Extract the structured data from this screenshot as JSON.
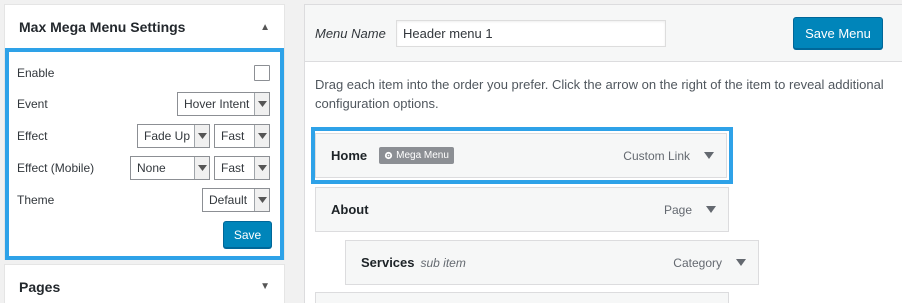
{
  "settings": {
    "title": "Max Mega Menu Settings",
    "enable_label": "Enable",
    "event_label": "Event",
    "event_value": "Hover Intent",
    "effect_label": "Effect",
    "effect_value": "Fade Up",
    "effect_speed": "Fast",
    "effect_mobile_label": "Effect (Mobile)",
    "effect_mobile_value": "None",
    "effect_mobile_speed": "Fast",
    "theme_label": "Theme",
    "theme_value": "Default",
    "save_label": "Save"
  },
  "pages": {
    "title": "Pages"
  },
  "editor": {
    "menu_name_label": "Menu Name",
    "menu_name_value": "Header menu 1",
    "save_menu_label": "Save Menu",
    "instructions": "Drag each item into the order you prefer. Click the arrow on the right of the item to reveal additional configuration options."
  },
  "menu_items": [
    {
      "title": "Home",
      "badge": "Mega Menu",
      "type": "Custom Link"
    },
    {
      "title": "About",
      "type": "Page"
    },
    {
      "title": "Services",
      "sub": "sub item",
      "type": "Category"
    }
  ],
  "colors": {
    "accent": "#2ea2e8",
    "button": "#0085ba"
  }
}
